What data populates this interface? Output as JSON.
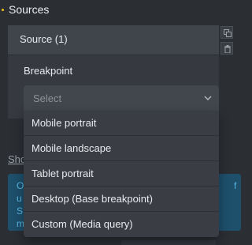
{
  "section": {
    "title": "Sources"
  },
  "panel": {
    "header_title": "Source (1)",
    "tools": [
      {
        "icon": "copy-icon"
      },
      {
        "icon": "trash-icon"
      }
    ],
    "breakpoint_label": "Breakpoint",
    "select": {
      "placeholder": "Select",
      "chevron_icon": "chevron-down-icon",
      "options": [
        "Mobile portrait",
        "Mobile landscape",
        "Tablet portrait",
        "Desktop (Base breakpoint)",
        "Custom (Media query)"
      ]
    }
  },
  "behind": {
    "link_fragment": "Sho",
    "info_fragments": [
      "O",
      "u",
      "S",
      "m",
      "f"
    ]
  },
  "colors": {
    "background": "#2b2e33",
    "panel": "#363a40",
    "accent_dot": "#f0c419",
    "info_bg": "#1e4f6b",
    "info_text": "#56b8e6"
  }
}
